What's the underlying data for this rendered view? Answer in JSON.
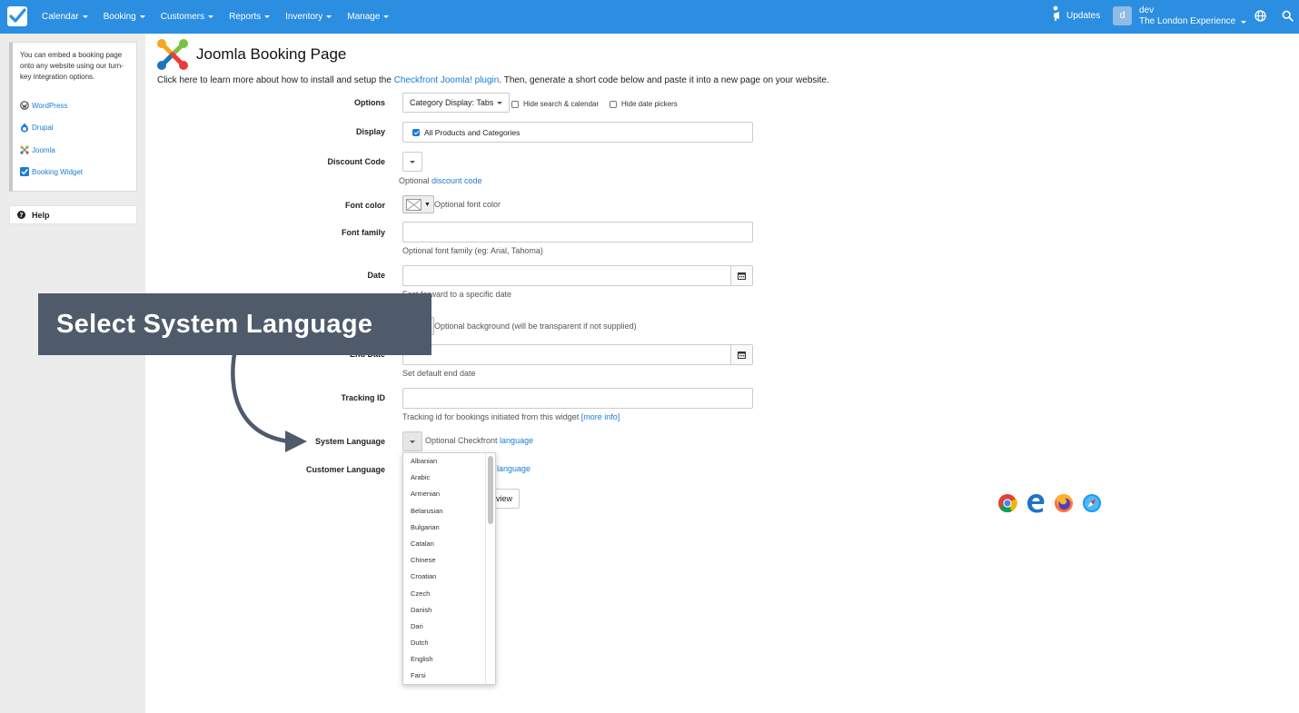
{
  "topbar": {
    "nav": [
      {
        "label": "Calendar"
      },
      {
        "label": "Booking"
      },
      {
        "label": "Customers"
      },
      {
        "label": "Reports"
      },
      {
        "label": "Inventory"
      },
      {
        "label": "Manage"
      }
    ],
    "updates_label": "Updates",
    "avatar_letter": "d",
    "user_name": "dev",
    "account_name": "The London Experience",
    "accent_color": "#2c8ee0"
  },
  "sidebar": {
    "intro": "You can embed a booking page onto any website using our turn-key integration options.",
    "links": [
      {
        "label": "WordPress",
        "icon": "wordpress-icon"
      },
      {
        "label": "Drupal",
        "icon": "drupal-icon"
      },
      {
        "label": "Joomla",
        "icon": "joomla-icon"
      },
      {
        "label": "Booking Widget",
        "icon": "checkfront-icon"
      }
    ],
    "help_label": "Help"
  },
  "main": {
    "title": "Joomla Booking Page",
    "intro_before": "Click here to learn more about how to install and setup the ",
    "intro_link": "Checkfront Joomla! plugin",
    "intro_after": ". Then, generate a short code below and paste it into a new page on your website.",
    "options": {
      "label": "Options",
      "category_display": "Category Display: Tabs",
      "hide_search": "Hide search & calendar",
      "hide_date_pickers": "Hide date pickers"
    },
    "display": {
      "label": "Display",
      "value": "All Products and Categories"
    },
    "discount": {
      "label": "Discount Code",
      "help_prefix": "Optional ",
      "help_link": "discount code"
    },
    "font_color": {
      "label": "Font color",
      "help": "Optional font color"
    },
    "font_family": {
      "label": "Font family",
      "help": "Optional font family (eg: Arial, Tahoma)"
    },
    "date": {
      "label": "Date",
      "help": "Fast forward to a specific date"
    },
    "background": {
      "help": "Optional background (will be transparent if not supplied)"
    },
    "end_date": {
      "label": "End Date",
      "help": "Set default end date"
    },
    "tracking": {
      "label": "Tracking ID",
      "help_before": "Tracking id for bookings initiated from this widget ",
      "help_link": "[more info]"
    },
    "system_language": {
      "label": "System Language",
      "help_prefix": "Optional Checkfront ",
      "help_link": "language",
      "options": [
        "Albanian",
        "Arabic",
        "Armenian",
        "Belarusian",
        "Bulgarian",
        "Catalan",
        "Chinese",
        "Croatian",
        "Czech",
        "Danish",
        "Dari",
        "Dutch",
        "English",
        "Farsi"
      ]
    },
    "customer_language": {
      "label": "Customer Language",
      "help_link": "language"
    },
    "preview_label": "view"
  },
  "overlay": {
    "callout": "Select System Language"
  }
}
